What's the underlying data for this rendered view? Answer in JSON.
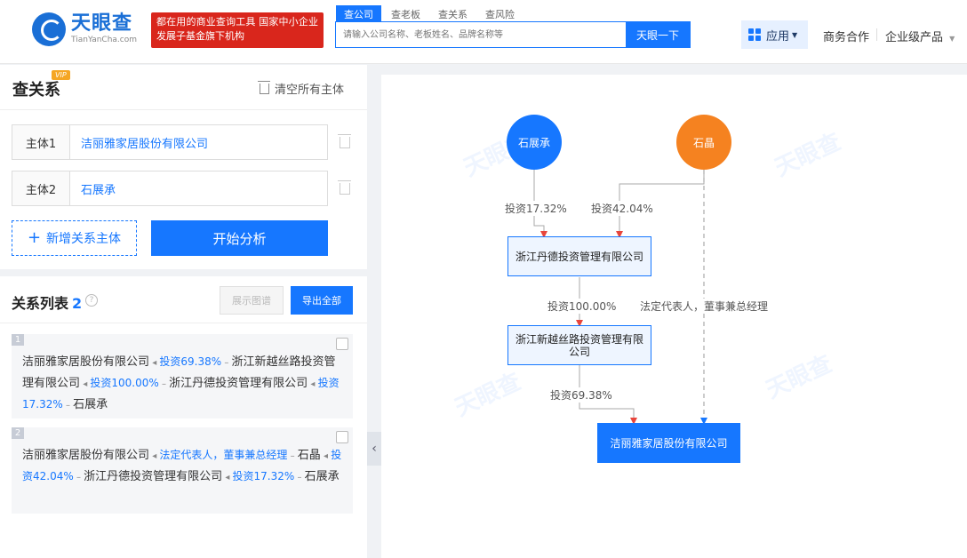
{
  "header": {
    "logo_cn": "天眼查",
    "logo_en": "TianYanCha.com",
    "slogan": "都在用的商业查询工具 国家中小企业发展子基金旗下机构",
    "search_tabs": [
      "查公司",
      "查老板",
      "查关系",
      "查风险"
    ],
    "search_placeholder": "请输入公司名称、老板姓名、品牌名称等",
    "search_button": "天眼一下",
    "nav": {
      "app": "应用",
      "business": "商务合作",
      "enterprise": "企业级产品"
    }
  },
  "left": {
    "title": "查关系",
    "vip": "VIP",
    "clear_all": "清空所有主体",
    "fields": [
      {
        "label": "主体1",
        "value": "洁丽雅家居股份有限公司"
      },
      {
        "label": "主体2",
        "value": "石展承"
      }
    ],
    "add_button": "新增关系主体",
    "start_button": "开始分析",
    "list_title": "关系列表",
    "list_count": "2",
    "show_graph": "展示图谱",
    "export_all": "导出全部",
    "paths": [
      {
        "num": "1",
        "segments": [
          {
            "t": "node",
            "v": "洁丽雅家居股份有限公司"
          },
          {
            "t": "rel",
            "v": "投资69.38%"
          },
          {
            "t": "node",
            "v": "浙江新越丝路投资管理有限公司"
          },
          {
            "t": "rel",
            "v": "投资100.00%"
          },
          {
            "t": "node",
            "v": "浙江丹德投资管理有限公司"
          },
          {
            "t": "rel",
            "v": "投资17.32%"
          },
          {
            "t": "node",
            "v": "石展承"
          }
        ]
      },
      {
        "num": "2",
        "segments": [
          {
            "t": "node",
            "v": "洁丽雅家居股份有限公司"
          },
          {
            "t": "rel",
            "v": "法定代表人，董事兼总经理"
          },
          {
            "t": "node",
            "v": "石晶"
          },
          {
            "t": "rel",
            "v": "投资42.04%"
          },
          {
            "t": "node",
            "v": "浙江丹德投资管理有限公司"
          },
          {
            "t": "rel",
            "v": "投资17.32%"
          },
          {
            "t": "node",
            "v": "石展承"
          }
        ]
      }
    ]
  },
  "graph": {
    "nodes": {
      "shi_zhancheng": "石展承",
      "shi_jing": "石晶",
      "dande": "浙江丹德投资管理有限公司",
      "xinyue": "浙江新越丝路投资管理有限公司",
      "jieliya": "洁丽雅家居股份有限公司"
    },
    "edges": {
      "e1": "投资17.32%",
      "e2": "投资42.04%",
      "e3": "投资100.00%",
      "e4": "投资69.38%",
      "e5": "法定代表人，董事兼总经理"
    },
    "watermark": "天眼查",
    "colors": {
      "person_blue": "#1677ff",
      "person_orange": "#f58220",
      "arrow": "#e8453c"
    }
  }
}
